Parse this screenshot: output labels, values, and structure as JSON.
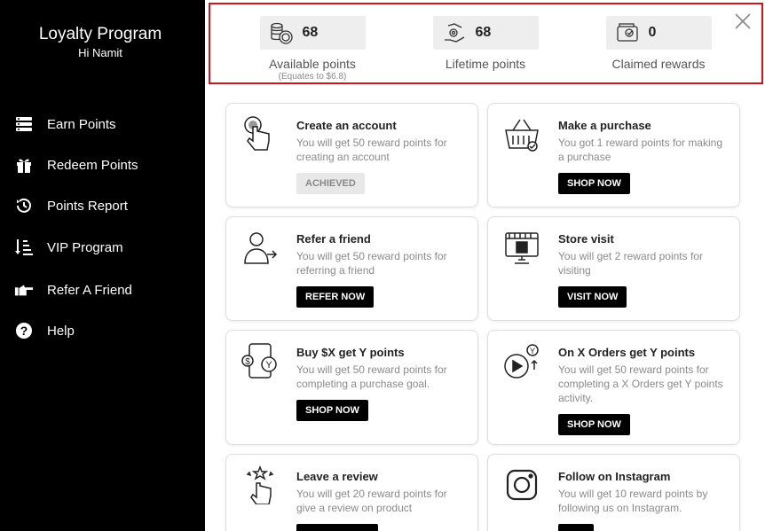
{
  "sidebar": {
    "title": "Loyalty Program",
    "greeting": "Hi Namit",
    "items": [
      {
        "label": "Earn Points",
        "icon": "earn-points-icon"
      },
      {
        "label": "Redeem Points",
        "icon": "gift-icon"
      },
      {
        "label": "Points Report",
        "icon": "history-icon"
      },
      {
        "label": "VIP Program",
        "icon": "sort-list-icon"
      },
      {
        "label": "Refer A Friend",
        "icon": "pointing-hand-icon"
      },
      {
        "label": "Help",
        "icon": "question-icon"
      }
    ]
  },
  "stats": {
    "available": {
      "value": "68",
      "label": "Available points",
      "note": "(Equates to $6.8)"
    },
    "lifetime": {
      "value": "68",
      "label": "Lifetime points"
    },
    "claimed": {
      "value": "0",
      "label": "Claimed rewards"
    }
  },
  "cards": [
    {
      "title": "Create an account",
      "desc": "You will get 50 reward points for creating an account",
      "button": "ACHIEVED"
    },
    {
      "title": "Make a purchase",
      "desc": "You got 1 reward points for making a purchase",
      "button": "SHOP NOW"
    },
    {
      "title": "Refer a friend",
      "desc": "You will get 50 reward points for referring a friend",
      "button": "REFER NOW"
    },
    {
      "title": "Store visit",
      "desc": "You will get 2 reward points for visiting",
      "button": "VISIT NOW"
    },
    {
      "title": "Buy $X get Y points",
      "desc": "You will get 50 reward points for completing a purchase goal.",
      "button": "SHOP NOW"
    },
    {
      "title": "On X Orders get Y points",
      "desc": "You will get 50 reward points for completing a X Orders get Y points activity.",
      "button": "SHOP NOW"
    },
    {
      "title": "Leave a review",
      "desc": "You will get 20 reward points for give a review on product",
      "button": ""
    },
    {
      "title": "Follow on Instagram",
      "desc": "You will get 10 reward points by following us on Instagram.",
      "button": ""
    }
  ],
  "colors": {
    "sidebar_bg": "#000000",
    "highlight_border": "#d0141c",
    "button_bg": "#000000"
  }
}
